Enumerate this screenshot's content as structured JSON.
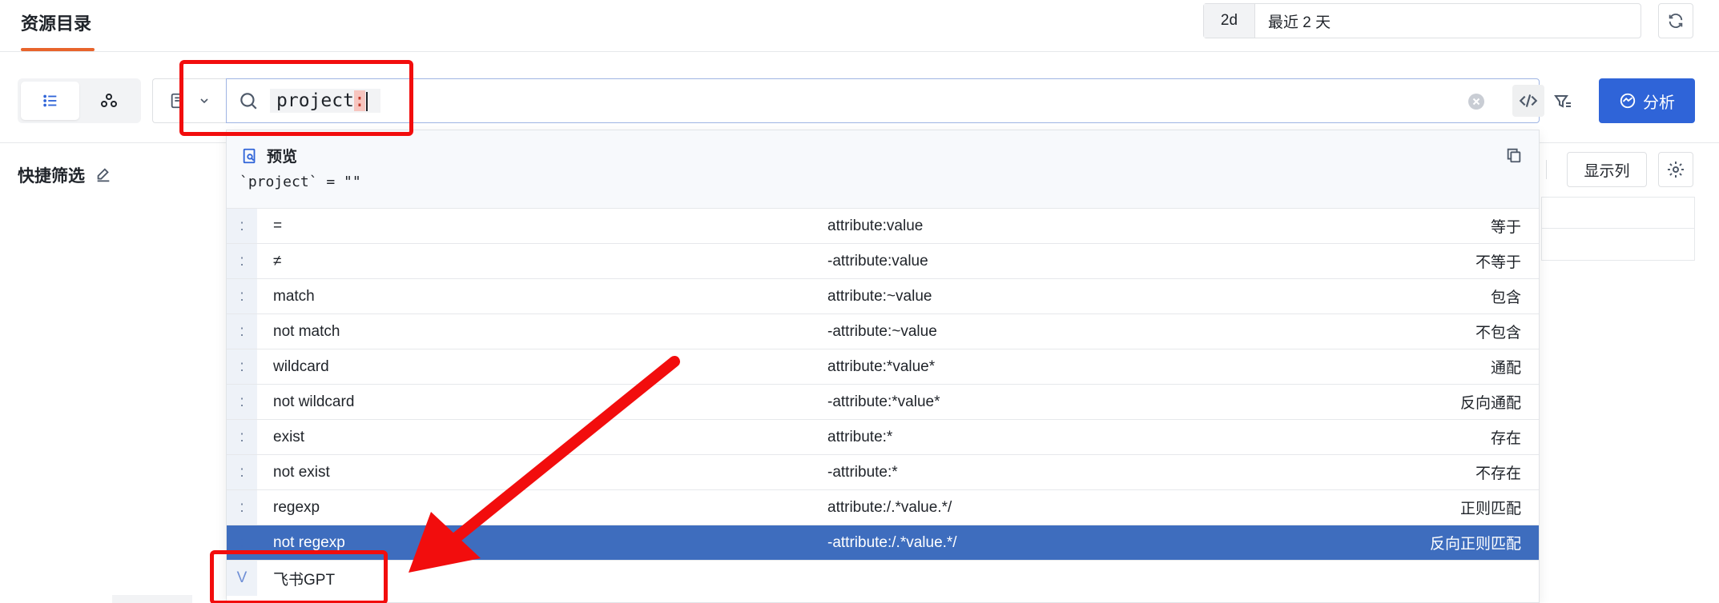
{
  "header": {
    "title": "资源目录",
    "time_range_short": "2d",
    "time_range_label": "最近 2 天"
  },
  "toolbar": {
    "search_value": "project",
    "search_suffix": ":",
    "analyze_label": "分析"
  },
  "left_panel": {
    "quick_filter_label": "快捷筛选"
  },
  "right_panel": {
    "display_columns_label": "显示列"
  },
  "dropdown": {
    "preview_title": "预览",
    "preview_query": "`project` = \"\"",
    "operators": [
      {
        "key": ":",
        "name": "=",
        "syntax": "attribute:value",
        "desc": "等于"
      },
      {
        "key": ":",
        "name": "≠",
        "syntax": "-attribute:value",
        "desc": "不等于"
      },
      {
        "key": ":",
        "name": "match",
        "syntax": "attribute:~value",
        "desc": "包含"
      },
      {
        "key": ":",
        "name": "not match",
        "syntax": "-attribute:~value",
        "desc": "不包含"
      },
      {
        "key": ":",
        "name": "wildcard",
        "syntax": "attribute:*value*",
        "desc": "通配"
      },
      {
        "key": ":",
        "name": "not wildcard",
        "syntax": "-attribute:*value*",
        "desc": "反向通配"
      },
      {
        "key": ":",
        "name": "exist",
        "syntax": "attribute:*",
        "desc": "存在"
      },
      {
        "key": ":",
        "name": "not exist",
        "syntax": "-attribute:*",
        "desc": "不存在"
      },
      {
        "key": ":",
        "name": "regexp",
        "syntax": "attribute:/.*value.*/",
        "desc": "正则匹配"
      },
      {
        "key": ":",
        "name": "not regexp",
        "syntax": "-attribute:/.*value.*/",
        "desc": "反向正则匹配",
        "selected": true
      }
    ],
    "values": [
      {
        "key": "V",
        "name": "飞书GPT"
      }
    ]
  },
  "colors": {
    "accent": "#2f64d8",
    "selected_row": "#3e6dbe",
    "tab_underline": "#e8642c",
    "annotation": "#f20d0d"
  },
  "icons": [
    "refresh-icon",
    "list-view-icon",
    "cluster-view-icon",
    "source-icon",
    "chevron-down-icon",
    "search-icon",
    "clear-icon",
    "code-icon",
    "filter-icon",
    "analyze-icon",
    "edit-icon",
    "settings-icon",
    "preview-icon",
    "copy-icon"
  ]
}
